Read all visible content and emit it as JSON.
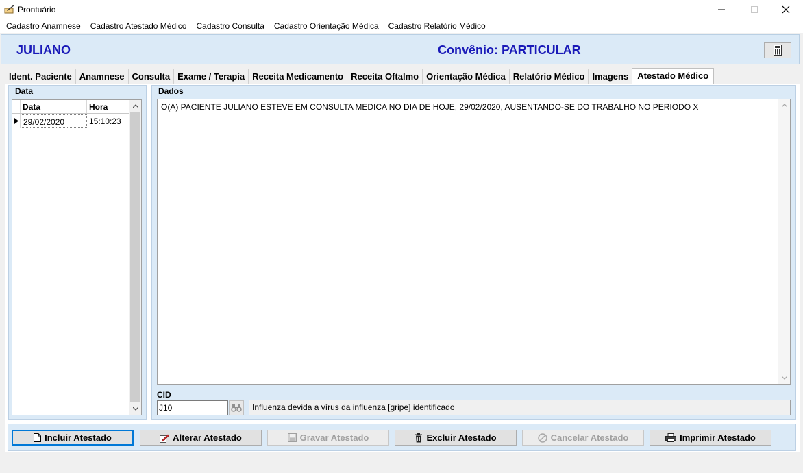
{
  "window": {
    "title": "Prontuário"
  },
  "menu": [
    "Cadastro Anamnese",
    "Cadastro Atestado Médico",
    "Cadastro Consulta",
    "Cadastro Orientação Médica",
    "Cadastro Relatório Médico"
  ],
  "header": {
    "patient_name": "JULIANO",
    "convenio": "Convênio: PARTICULAR"
  },
  "tabs": [
    "Ident. Paciente",
    "Anamnese",
    "Consulta",
    "Exame / Terapia",
    "Receita Medicamento",
    "Receita Oftalmo",
    "Orientação Médica",
    "Relatório Médico",
    "Imagens",
    "Atestado Médico"
  ],
  "active_tab": "Atestado Médico",
  "data_group": {
    "title": "Data",
    "columns": [
      "Data",
      "Hora"
    ],
    "rows": [
      {
        "data": "29/02/2020",
        "hora": "15:10:23"
      }
    ]
  },
  "dados_group": {
    "title": "Dados",
    "text": "O(A) PACIENTE JULIANO ESTEVE EM CONSULTA MEDICA NO DIA DE HOJE, 29/02/2020, AUSENTANDO-SE DO TRABALHO NO PERIODO X"
  },
  "cid": {
    "label": "CID",
    "code": "J10",
    "description": "Influenza devida a vírus da influenza [gripe] identificado"
  },
  "buttons": {
    "incluir": "Incluir Atestado",
    "alterar": "Alterar Atestado",
    "gravar": "Gravar Atestado",
    "excluir": "Excluir Atestado",
    "cancelar": "Cancelar Atestado",
    "imprimir": "Imprimir Atestado"
  },
  "colors": {
    "header_bg": "#dbeaf7",
    "header_text": "#1a1ab8",
    "focus": "#0078d7"
  }
}
